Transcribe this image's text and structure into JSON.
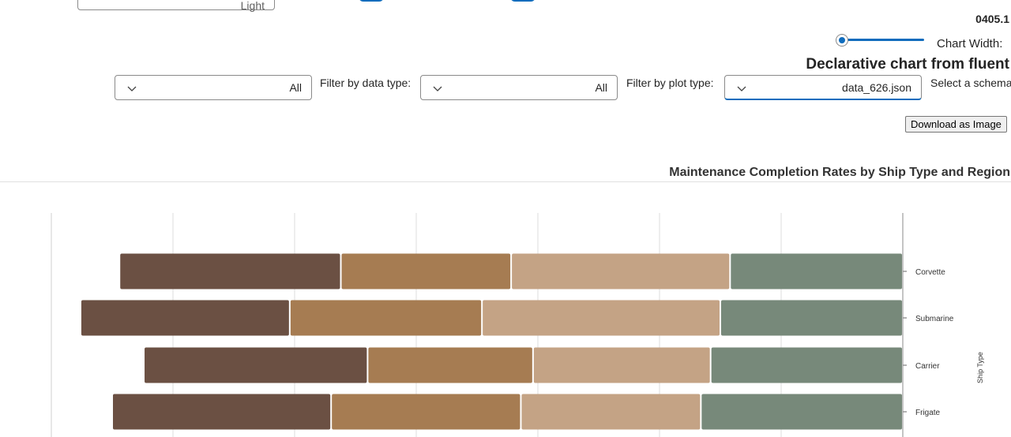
{
  "theme_select": {
    "value": "Light"
  },
  "version": "0405.1",
  "chart_width": {
    "label": ":Chart Width",
    "level": 0.0
  },
  "page_title": "Declarative chart from fluent",
  "filters": {
    "data_type": {
      "label": ":Filter by data type",
      "value": "All"
    },
    "plot_type": {
      "label": ":Filter by plot type",
      "value": "All"
    },
    "schema": {
      "label": ":Select a schema",
      "value": "data_626.json"
    }
  },
  "download_button": "Download as Image",
  "colors": {
    "accent": "#0f6cbd",
    "series": [
      "#77897a",
      "#c4a385",
      "#a67c52",
      "#6b5043"
    ]
  },
  "chart_data": {
    "type": "bar",
    "orientation": "horizontal",
    "stacked": true,
    "title": "Maintenance Completion Rates by Ship Type and Region",
    "ylabel": "Ship Type",
    "categories": [
      "Corvette",
      "Submarine",
      "Carrier",
      "Frigate"
    ],
    "series": [
      {
        "values": [
          71,
          75,
          79,
          83
        ]
      },
      {
        "values": [
          90,
          98,
          73,
          74
        ]
      },
      {
        "values": [
          70,
          79,
          68,
          78
        ]
      },
      {
        "values": [
          91,
          86,
          92,
          90
        ]
      }
    ],
    "xlim": [
      350,
      0
    ],
    "grid": true
  }
}
